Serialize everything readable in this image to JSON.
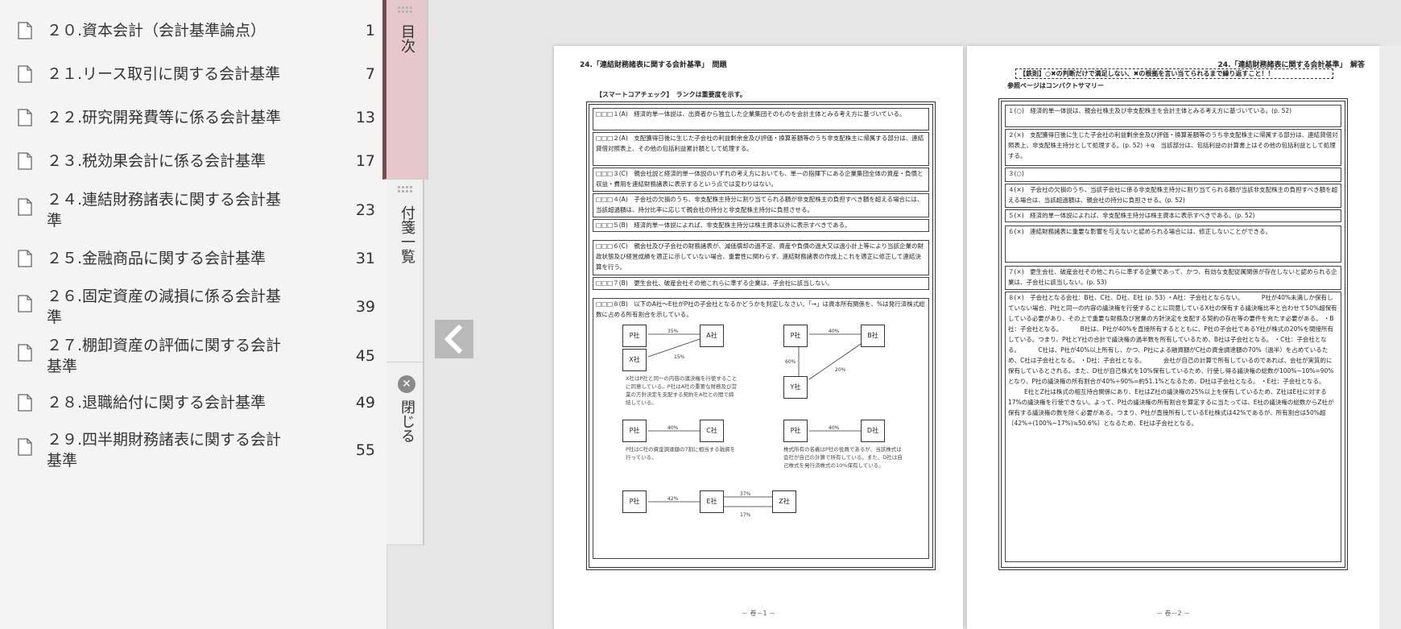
{
  "toc": {
    "items": [
      {
        "label": "２０.資本会計（会計基準論点）",
        "page": "1"
      },
      {
        "label": "２１.リース取引に関する会計基準",
        "page": "7"
      },
      {
        "label": "２２.研究開発費等に係る会計基準",
        "page": "13"
      },
      {
        "label": "２３.税効果会計に係る会計基準",
        "page": "17"
      },
      {
        "label": "２４.連結財務諸表に関する会計基準",
        "page": "23"
      },
      {
        "label": "２５.金融商品に関する会計基準",
        "page": "31"
      },
      {
        "label": "２６.固定資産の減損に係る会計基準",
        "page": "39"
      },
      {
        "label": "２７.棚卸資産の評価に関する会計基準",
        "page": "45"
      },
      {
        "label": "２８.退職給付に関する会計基準",
        "page": "49"
      },
      {
        "label": "２９.四半期財務諸表に関する会計基準",
        "page": "55"
      }
    ]
  },
  "tabs": {
    "contents": "目次",
    "sticky_list": "付箋一覧",
    "close": "閉じる"
  },
  "left_page": {
    "header": "24.「連結財務諸表に関する会計基準」　問題",
    "check_title": "【スマートコアチェック】　ランクは重要度を示す。",
    "questions": [
      "□□□１(A)　経済的単一体説は、出資者から独立した企業集団そのものを会計主体とみる考え方に基づいている。",
      "□□□２(A)　支配獲得日後に生じた子会社の利益剰余金及び評価・換算差額等のうち非支配株主に帰属する部分は、連結貸借対照表上、その他の包括利益累計額として処理する。",
      "□□□３(C)　親会社説と経済的単一体説のいずれの考え方においても、単一の指揮下にある企業集団全体の資産・負債と収益・費用を連結財務諸表に表示するという点では変わりはない。",
      "□□□４(A)　子会社の欠損のうち、非支配株主持分に割り当てられる額が非支配株主の負担すべき額を超える場合には、当該超過額は、持分比率に応じて親会社の持分と非支配株主持分に負担させる。",
      "□□□５(B)　経済的単一体説によれば、非支配株主持分は株主資本以外に表示すべきである。",
      "□□□６(C)　親会社及び子会社の財務諸表が、減価償却の過不足、資産や負債の過大又は過小計上等により当該企業の財政状態及び経営成績を適正に示していない場合、重要性に関わらず、連結財務諸表の作成上これを適正に修正して連結決算を行う。",
      "□□□７(B)　更生会社、破産会社その他これらに準ずる企業は、子会社に該当しない。",
      "□□□８(B)　以下のA社〜E社がP社の子会社となるかどうかを判定しなさい。「→」は資本所有関係を、%は発行済株式総数に占める所有割合を示している。"
    ],
    "diagram": {
      "boxes": [
        "P社",
        "A社",
        "X社",
        "P社",
        "B社",
        "Y社",
        "P社",
        "C社",
        "P社",
        "D社",
        "P社",
        "E社",
        "Z社"
      ],
      "pcts": [
        "35%",
        "15%",
        "40%",
        "60%",
        "20%",
        "40%",
        "40%",
        "42%",
        "37%",
        "17%"
      ],
      "notes": [
        "X社はP社と同一の内容の議決権を行使することに同意している。P社はA社の重要な財務及び営業の方針決定を支配する契約をA社との間で締結している。",
        "P社はC社の資金調達額の7割に相当する融資を行っている。",
        "株式所有の名義はP社の役員であるが、当該株式は会社が自己の計算で所有している。また、D社は自己株式を発行済株式の10%保有している。"
      ]
    },
    "footer": "－ 卷－1 －"
  },
  "right_page": {
    "header": "24.「連結財務諸表に関する会計基準」　解答",
    "banner": "【鉄則】○✖の判断だけで満足しない、✖の根拠を言い当てられるまで繰り返すこと！！",
    "ref_note": "参照ページはコンパクトサマリー",
    "answers": [
      "１(○)　経済的単一体説は、親会社株主及び非支配株主を会計主体とみる考え方に基づいている。(p. 52)",
      "２(×)　支配獲得日後に生じた子会社の利益剰余金及び評価・換算差額等のうち非支配株主に帰属する部分は、連結貸借対照表上、非支配株主持分として処理する。(p. 52)",
      "＋α　当該部分は、包括利益の計算書上はその他の包括利益として処理する。",
      "３(○)",
      "４(×)　子会社の欠損のうち、当該子会社に係る非支配株主持分に割り当てられる額が当該非支配株主の負担すべき額を超える場合は、当該超過額は、親会社の持分に負担させる。(p. 52)",
      "５(×)　経済的単一体説によれば、非支配株主持分は株主資本に表示すべきである。(p. 52)",
      "６(×)　連結財務諸表に重要な影響を与えないと認められる場合には、修正しないことができる。",
      "７(×)　更生会社、破産会社その他これらに準ずる企業であって、かつ、有効な支配従属関係が存在しないと認められる企業は、子会社に該当しない。(p. 53)",
      "８(×)　子会社となる会社：B社、C社、D社、E社 (p. 53)",
      "・A社：子会社とならない。",
      "P社が40%未満しか保有していない場合、P社と同一の内容の議決権を行使することに同意しているX社の保有する議決権比率と合わせて50%超保有している必要があり、その上で重要な財務及び営業の方針決定を支配する契約の存在等の要件を充たす必要がある。",
      "・B社：子会社となる。",
      "B社は、P社が40%を直接所有するとともに、P社の子会社であるY社が株式の20%を間接所有している。つまり、P社とY社の合計で議決権の過半数を所有しているため、B社は子会社となる。",
      "・C社：子会社となる。",
      "C社は、P社が40%以上所有し、かつ、P社による融資額がC社の資金調達額の70%（過半）を占めているため、C社は子会社となる。",
      "・D社：子会社となる。",
      "会社が自己の計算で所有しているのであれば、会社が実質的に保有しているとされる。また、D社が自己株式を10%保有しているため、行使し得る議決権の総数が100%−10%=90%となり、P社の議決権の所有割合が40%÷90%=約51.1%となるため、D社は子会社となる。",
      "・E社：子会社となる。",
      "E社とZ社は株式の相互持合関係にあり、E社はZ社の議決権の25%以上を保有しているため、Z社はE社に対する17%の議決権を行使できない。よって、P社の議決権の所有割合を算定するに当たっては、E社の議決権の総数からZ社が保有する議決権の数を除く必要がある。つまり、P社が直接所有しているE社株式は42%であるが、所有割合は50%超〔42%÷(100%−17%)≒50.6%〕となるため、E社は子会社となる。"
    ],
    "footer": "－ 卷－2 －"
  },
  "colors": {
    "active_tab": "#e6c7cc",
    "active_tab_border": "#7a4a52",
    "nav_button": "#b9b9b9"
  },
  "icons": {
    "toc_item": "document-icon",
    "prev": "chevron-left-icon",
    "close": "close-icon"
  }
}
